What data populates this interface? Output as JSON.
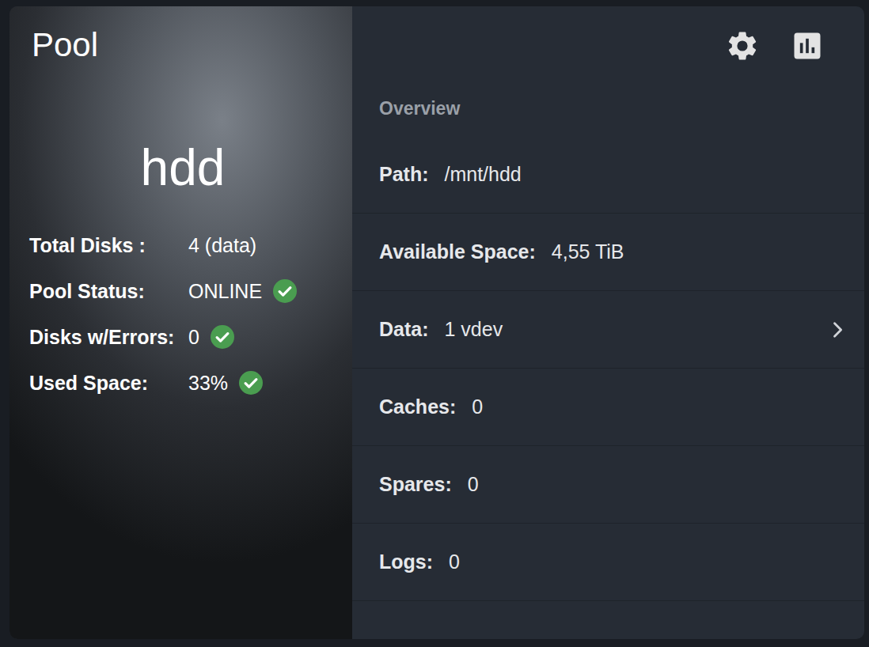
{
  "card": {
    "title": "Pool"
  },
  "pool": {
    "name": "hdd",
    "stats": [
      {
        "label": "Total Disks :",
        "value": "4 (data)",
        "ok": false
      },
      {
        "label": "Pool Status:",
        "value": "ONLINE",
        "ok": true
      },
      {
        "label": "Disks w/Errors:",
        "value": "0",
        "ok": true
      },
      {
        "label": "Used Space:",
        "value": "33%",
        "ok": true
      }
    ]
  },
  "overview": {
    "heading": "Overview",
    "rows": [
      {
        "label": "Path:",
        "value": "/mnt/hdd",
        "expandable": false
      },
      {
        "label": "Available Space:",
        "value": "4,55 TiB",
        "expandable": false
      },
      {
        "label": "Data:",
        "value": "1 vdev",
        "expandable": true
      },
      {
        "label": "Caches:",
        "value": "0",
        "expandable": false
      },
      {
        "label": "Spares:",
        "value": "0",
        "expandable": false
      },
      {
        "label": "Logs:",
        "value": "0",
        "expandable": false
      }
    ]
  }
}
